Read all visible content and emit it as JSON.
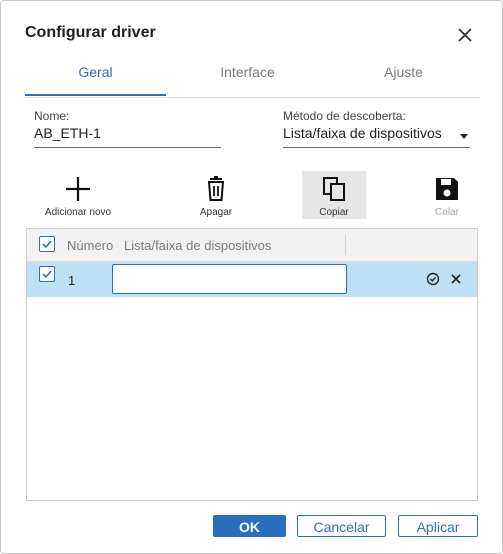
{
  "dialog": {
    "title": "Configurar driver"
  },
  "tabs": [
    {
      "label": "Geral",
      "active": true
    },
    {
      "label": "Interface",
      "active": false
    },
    {
      "label": "Ajuste",
      "active": false
    }
  ],
  "form": {
    "name_label": "Nome:",
    "name_value": "AB_ETH-1",
    "method_label": "Método de descoberta:",
    "method_value": "Lista/faixa de dispositivos"
  },
  "toolbar": {
    "add_label": "Adicionar novo",
    "delete_label": "Apagar",
    "copy_label": "Copiar",
    "paste_label": "Colar"
  },
  "grid": {
    "columns": [
      "Número",
      "Lista/faixa de dispositivos"
    ],
    "rows": [
      {
        "number": "1",
        "value": "",
        "selected": true
      }
    ]
  },
  "footer": {
    "ok_label": "OK",
    "cancel_label": "Cancelar",
    "apply_label": "Aplicar"
  },
  "colors": {
    "accent": "#2a6ebd",
    "selected_row": "#bfe0f4"
  },
  "icons": [
    "close-icon",
    "plus-icon",
    "trash-icon",
    "copy-icon",
    "save-icon",
    "checkbox-icon",
    "confirm-icon",
    "cancel-icon"
  ]
}
